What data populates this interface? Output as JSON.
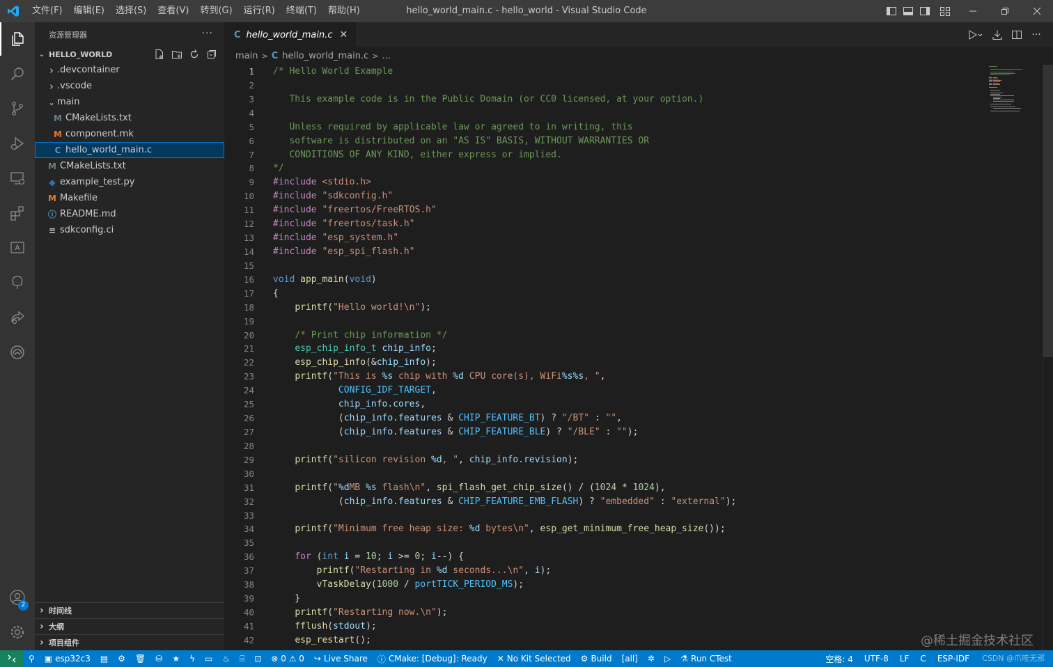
{
  "window": {
    "title": "hello_world_main.c - hello_world - Visual Studio Code",
    "menus": [
      "文件(F)",
      "编辑(E)",
      "选择(S)",
      "查看(V)",
      "转到(G)",
      "运行(R)",
      "终端(T)",
      "帮助(H)"
    ]
  },
  "activity_bar": {
    "items": [
      "explorer-icon",
      "search-icon",
      "source-control-icon",
      "run-debug-icon",
      "remote-explorer-icon",
      "extensions-icon",
      "esp-idf-icon",
      "tree-icon",
      "live-share-icon",
      "esp-rainbow-icon"
    ],
    "accounts_badge": "2"
  },
  "sidebar": {
    "header": "资源管理器",
    "more": "···",
    "root": "HELLO_WORLD",
    "tree": [
      {
        "label": ".devcontainer",
        "kind": "folder",
        "indent": 1,
        "expanded": false
      },
      {
        "label": ".vscode",
        "kind": "folder",
        "indent": 1,
        "expanded": false
      },
      {
        "label": "main",
        "kind": "folder",
        "indent": 1,
        "expanded": true
      },
      {
        "label": "CMakeLists.txt",
        "kind": "m",
        "indent": 2
      },
      {
        "label": "component.mk",
        "kind": "m-orange",
        "indent": 2
      },
      {
        "label": "hello_world_main.c",
        "kind": "c",
        "indent": 2,
        "selected": true
      },
      {
        "label": "CMakeLists.txt",
        "kind": "m",
        "indent": 1
      },
      {
        "label": "example_test.py",
        "kind": "py",
        "indent": 1
      },
      {
        "label": "Makefile",
        "kind": "m-orange",
        "indent": 1
      },
      {
        "label": "README.md",
        "kind": "info",
        "indent": 1
      },
      {
        "label": "sdkconfig.ci",
        "kind": "txt",
        "indent": 1
      }
    ],
    "bottom_sections": [
      "时间线",
      "大纲",
      "项目组件"
    ]
  },
  "editor": {
    "tab_label": "hello_world_main.c",
    "tab_glyph": "C",
    "breadcrumb": {
      "folder": "main",
      "file": "hello_world_main.c",
      "ellipsis": "..."
    },
    "current_line": 1
  },
  "code_lines": [
    [
      [
        "comment",
        "/* Hello World Example"
      ]
    ],
    [],
    [
      [
        "comment",
        "   This example code is in the Public Domain (or CC0 licensed, at your option.)"
      ]
    ],
    [],
    [
      [
        "comment",
        "   Unless required by applicable law or agreed to in writing, this"
      ]
    ],
    [
      [
        "comment",
        "   software is distributed on an \"AS IS\" BASIS, WITHOUT WARRANTIES OR"
      ]
    ],
    [
      [
        "comment",
        "   CONDITIONS OF ANY KIND, either express or implied."
      ]
    ],
    [
      [
        "comment",
        "*/"
      ]
    ],
    [
      [
        "macro",
        "#include"
      ],
      [
        "plain",
        " "
      ],
      [
        "string",
        "<stdio.h>"
      ]
    ],
    [
      [
        "macro",
        "#include"
      ],
      [
        "plain",
        " "
      ],
      [
        "string",
        "\"sdkconfig.h\""
      ]
    ],
    [
      [
        "macro",
        "#include"
      ],
      [
        "plain",
        " "
      ],
      [
        "string",
        "\"freertos/FreeRTOS.h\""
      ]
    ],
    [
      [
        "macro",
        "#include"
      ],
      [
        "plain",
        " "
      ],
      [
        "string",
        "\"freertos/task.h\""
      ]
    ],
    [
      [
        "macro",
        "#include"
      ],
      [
        "plain",
        " "
      ],
      [
        "string",
        "\"esp_system.h\""
      ]
    ],
    [
      [
        "macro",
        "#include"
      ],
      [
        "plain",
        " "
      ],
      [
        "string",
        "\"esp_spi_flash.h\""
      ]
    ],
    [],
    [
      [
        "keyword",
        "void"
      ],
      [
        "plain",
        " "
      ],
      [
        "func",
        "app_main"
      ],
      [
        "plain",
        "("
      ],
      [
        "keyword",
        "void"
      ],
      [
        "plain",
        ")"
      ]
    ],
    [
      [
        "plain",
        "{"
      ]
    ],
    [
      [
        "plain",
        "    "
      ],
      [
        "func",
        "printf"
      ],
      [
        "plain",
        "("
      ],
      [
        "string",
        "\"Hello world!\\n\""
      ],
      [
        "plain",
        ");"
      ]
    ],
    [],
    [
      [
        "plain",
        "    "
      ],
      [
        "comment",
        "/* Print chip information */"
      ]
    ],
    [
      [
        "plain",
        "    "
      ],
      [
        "type",
        "esp_chip_info_t"
      ],
      [
        "plain",
        " "
      ],
      [
        "var",
        "chip_info"
      ],
      [
        "plain",
        ";"
      ]
    ],
    [
      [
        "plain",
        "    "
      ],
      [
        "func",
        "esp_chip_info"
      ],
      [
        "plain",
        "(&"
      ],
      [
        "var",
        "chip_info"
      ],
      [
        "plain",
        ");"
      ]
    ],
    [
      [
        "plain",
        "    "
      ],
      [
        "func",
        "printf"
      ],
      [
        "plain",
        "("
      ],
      [
        "string",
        "\"This is "
      ],
      [
        "fmt",
        "%s"
      ],
      [
        "string",
        " chip with "
      ],
      [
        "fmt",
        "%d"
      ],
      [
        "string",
        " CPU core(s), WiFi"
      ],
      [
        "fmt",
        "%s%s"
      ],
      [
        "string",
        ", \""
      ],
      [
        "plain",
        ","
      ]
    ],
    [
      [
        "plain",
        "            "
      ],
      [
        "const",
        "CONFIG_IDF_TARGET"
      ],
      [
        "plain",
        ","
      ]
    ],
    [
      [
        "plain",
        "            "
      ],
      [
        "var",
        "chip_info"
      ],
      [
        "plain",
        "."
      ],
      [
        "var",
        "cores"
      ],
      [
        "plain",
        ","
      ]
    ],
    [
      [
        "plain",
        "            ("
      ],
      [
        "var",
        "chip_info"
      ],
      [
        "plain",
        "."
      ],
      [
        "var",
        "features"
      ],
      [
        "plain",
        " & "
      ],
      [
        "const",
        "CHIP_FEATURE_BT"
      ],
      [
        "plain",
        ") ? "
      ],
      [
        "string",
        "\"/BT\""
      ],
      [
        "plain",
        " : "
      ],
      [
        "string",
        "\"\""
      ],
      [
        "plain",
        ","
      ]
    ],
    [
      [
        "plain",
        "            ("
      ],
      [
        "var",
        "chip_info"
      ],
      [
        "plain",
        "."
      ],
      [
        "var",
        "features"
      ],
      [
        "plain",
        " & "
      ],
      [
        "const",
        "CHIP_FEATURE_BLE"
      ],
      [
        "plain",
        ") ? "
      ],
      [
        "string",
        "\"/BLE\""
      ],
      [
        "plain",
        " : "
      ],
      [
        "string",
        "\"\""
      ],
      [
        "plain",
        ");"
      ]
    ],
    [],
    [
      [
        "plain",
        "    "
      ],
      [
        "func",
        "printf"
      ],
      [
        "plain",
        "("
      ],
      [
        "string",
        "\"silicon revision "
      ],
      [
        "fmt",
        "%d"
      ],
      [
        "string",
        ", \""
      ],
      [
        "plain",
        ", "
      ],
      [
        "var",
        "chip_info"
      ],
      [
        "plain",
        "."
      ],
      [
        "var",
        "revision"
      ],
      [
        "plain",
        ");"
      ]
    ],
    [],
    [
      [
        "plain",
        "    "
      ],
      [
        "func",
        "printf"
      ],
      [
        "plain",
        "("
      ],
      [
        "string",
        "\""
      ],
      [
        "fmt",
        "%d"
      ],
      [
        "string",
        "MB "
      ],
      [
        "fmt",
        "%s"
      ],
      [
        "string",
        " flash\\n\""
      ],
      [
        "plain",
        ", "
      ],
      [
        "func",
        "spi_flash_get_chip_size"
      ],
      [
        "plain",
        "() / ("
      ],
      [
        "num",
        "1024"
      ],
      [
        "plain",
        " * "
      ],
      [
        "num",
        "1024"
      ],
      [
        "plain",
        "),"
      ]
    ],
    [
      [
        "plain",
        "            ("
      ],
      [
        "var",
        "chip_info"
      ],
      [
        "plain",
        "."
      ],
      [
        "var",
        "features"
      ],
      [
        "plain",
        " & "
      ],
      [
        "const",
        "CHIP_FEATURE_EMB_FLASH"
      ],
      [
        "plain",
        ") ? "
      ],
      [
        "string",
        "\"embedded\""
      ],
      [
        "plain",
        " : "
      ],
      [
        "string",
        "\"external\""
      ],
      [
        "plain",
        ");"
      ]
    ],
    [],
    [
      [
        "plain",
        "    "
      ],
      [
        "func",
        "printf"
      ],
      [
        "plain",
        "("
      ],
      [
        "string",
        "\"Minimum free heap size: "
      ],
      [
        "fmt",
        "%d"
      ],
      [
        "string",
        " bytes\\n\""
      ],
      [
        "plain",
        ", "
      ],
      [
        "func",
        "esp_get_minimum_free_heap_size"
      ],
      [
        "plain",
        "());"
      ]
    ],
    [],
    [
      [
        "plain",
        "    "
      ],
      [
        "macro",
        "for"
      ],
      [
        "plain",
        " ("
      ],
      [
        "keyword",
        "int"
      ],
      [
        "plain",
        " "
      ],
      [
        "var",
        "i"
      ],
      [
        "plain",
        " = "
      ],
      [
        "num",
        "10"
      ],
      [
        "plain",
        "; "
      ],
      [
        "var",
        "i"
      ],
      [
        "plain",
        " >= "
      ],
      [
        "num",
        "0"
      ],
      [
        "plain",
        "; "
      ],
      [
        "var",
        "i"
      ],
      [
        "plain",
        "--) {"
      ]
    ],
    [
      [
        "plain",
        "        "
      ],
      [
        "func",
        "printf"
      ],
      [
        "plain",
        "("
      ],
      [
        "string",
        "\"Restarting in "
      ],
      [
        "fmt",
        "%d"
      ],
      [
        "string",
        " seconds...\\n\""
      ],
      [
        "plain",
        ", "
      ],
      [
        "var",
        "i"
      ],
      [
        "plain",
        ");"
      ]
    ],
    [
      [
        "plain",
        "        "
      ],
      [
        "func",
        "vTaskDelay"
      ],
      [
        "plain",
        "("
      ],
      [
        "num",
        "1000"
      ],
      [
        "plain",
        " / "
      ],
      [
        "const",
        "portTICK_PERIOD_MS"
      ],
      [
        "plain",
        ");"
      ]
    ],
    [
      [
        "plain",
        "    }"
      ]
    ],
    [
      [
        "plain",
        "    "
      ],
      [
        "func",
        "printf"
      ],
      [
        "plain",
        "("
      ],
      [
        "string",
        "\"Restarting now.\\n\""
      ],
      [
        "plain",
        ");"
      ]
    ],
    [
      [
        "plain",
        "    "
      ],
      [
        "func",
        "fflush"
      ],
      [
        "plain",
        "("
      ],
      [
        "var",
        "stdout"
      ],
      [
        "plain",
        ");"
      ]
    ],
    [
      [
        "plain",
        "    "
      ],
      [
        "func",
        "esp_restart"
      ],
      [
        "plain",
        "();"
      ]
    ]
  ],
  "statusbar": {
    "left": [
      {
        "icon": "plug-icon",
        "label": ""
      },
      {
        "icon": "chip-icon",
        "label": "esp32c3"
      },
      {
        "icon": "folder-icon",
        "label": ""
      },
      {
        "icon": "gear-icon",
        "label": ""
      },
      {
        "icon": "trash-icon",
        "label": ""
      },
      {
        "icon": "database-icon",
        "label": ""
      },
      {
        "icon": "star-icon",
        "label": ""
      },
      {
        "icon": "flash-icon",
        "label": ""
      },
      {
        "icon": "monitor-icon",
        "label": ""
      },
      {
        "icon": "fire-icon",
        "label": ""
      },
      {
        "icon": "terminal-icon",
        "label": ""
      },
      {
        "icon": "play-box-icon",
        "label": ""
      },
      {
        "icon": "problems-icon",
        "label": "⊗ 0 ⚠ 0"
      },
      {
        "icon": "live-share-icon",
        "label": "Live Share"
      },
      {
        "icon": "info-icon",
        "label": "CMake: [Debug]: Ready"
      },
      {
        "icon": "tools-icon",
        "label": "No Kit Selected"
      },
      {
        "icon": "gear-icon",
        "label": "Build"
      },
      {
        "icon": "",
        "label": "[all]"
      },
      {
        "icon": "bug-icon",
        "label": ""
      },
      {
        "icon": "play-icon",
        "label": ""
      },
      {
        "icon": "flask-icon",
        "label": "Run CTest"
      }
    ],
    "right": [
      "空格: 4",
      "UTF-8",
      "LF",
      "C",
      "ESP-IDF"
    ]
  },
  "watermark": "@稀土掘金技术社区",
  "watermark_small": "CSDN @爪哇无邪"
}
